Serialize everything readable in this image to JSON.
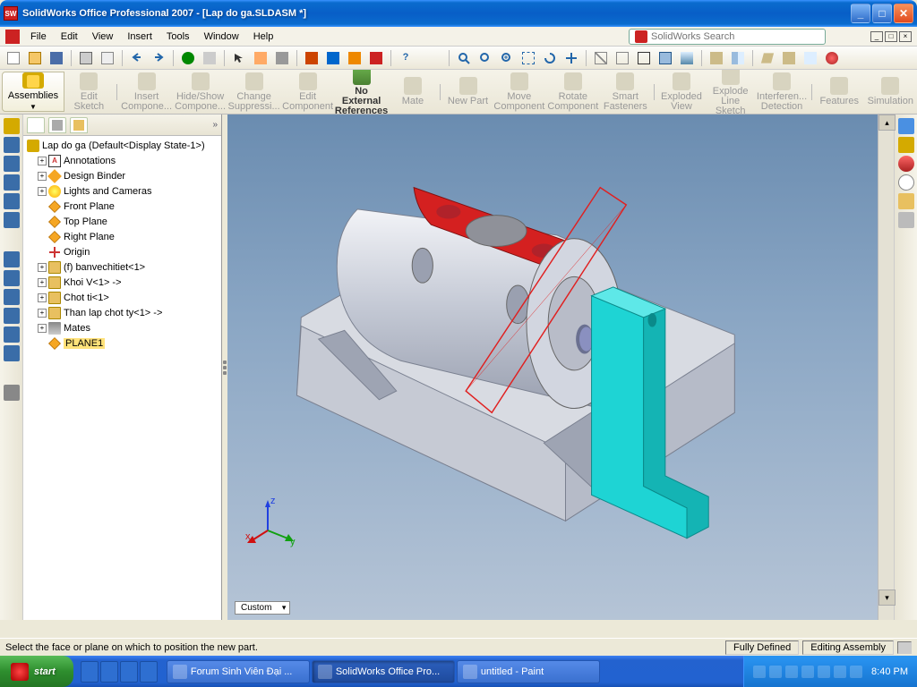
{
  "title": "SolidWorks Office Professional 2007 - [Lap do ga.SLDASM *]",
  "app_icon_text": "SW",
  "menus": [
    "File",
    "Edit",
    "View",
    "Insert",
    "Tools",
    "Window",
    "Help"
  ],
  "search": {
    "placeholder": "SolidWorks Search"
  },
  "ribbon": {
    "tab": "Assemblies",
    "buttons": [
      "Edit Sketch",
      "Insert Compone...",
      "Hide/Show Compone...",
      "Change Suppressi...",
      "Edit Component",
      "No External References",
      "Mate",
      "New Part",
      "Move Component",
      "Rotate Component",
      "Smart Fasteners",
      "Exploded View",
      "Explode Line Sketch",
      "Interferen... Detection",
      "Features",
      "Simulation"
    ],
    "active_index": 5
  },
  "tree": {
    "root": "Lap do ga  (Default<Display State-1>)",
    "items": [
      {
        "exp": "+",
        "icon": "ann",
        "label": "Annotations"
      },
      {
        "exp": "+",
        "icon": "db",
        "label": "Design Binder"
      },
      {
        "exp": "+",
        "icon": "light",
        "label": "Lights and Cameras"
      },
      {
        "exp": "",
        "icon": "plane",
        "label": "Front Plane"
      },
      {
        "exp": "",
        "icon": "plane",
        "label": "Top Plane"
      },
      {
        "exp": "",
        "icon": "plane",
        "label": "Right Plane"
      },
      {
        "exp": "",
        "icon": "origin",
        "label": "Origin"
      },
      {
        "exp": "+",
        "icon": "part",
        "label": "(f) banvechitiet<1>"
      },
      {
        "exp": "+",
        "icon": "part",
        "label": "Khoi V<1> ->"
      },
      {
        "exp": "+",
        "icon": "part",
        "label": "Chot ti<1>"
      },
      {
        "exp": "+",
        "icon": "part",
        "label": "Than lap chot ty<1> ->"
      },
      {
        "exp": "+",
        "icon": "mate",
        "label": "Mates"
      },
      {
        "exp": "",
        "icon": "plane",
        "label": "PLANE1",
        "sel": true
      }
    ]
  },
  "viewport": {
    "custom": "Custom"
  },
  "status": {
    "hint": "Select the face or plane on which to position the new part.",
    "defined": "Fully Defined",
    "mode": "Editing Assembly"
  },
  "taskbar": {
    "start": "start",
    "tasks": [
      {
        "label": "Forum Sinh Viên Đại ...",
        "active": false
      },
      {
        "label": "SolidWorks Office Pro...",
        "active": true
      },
      {
        "label": "untitled - Paint",
        "active": false
      }
    ],
    "clock": "8:40 PM"
  }
}
